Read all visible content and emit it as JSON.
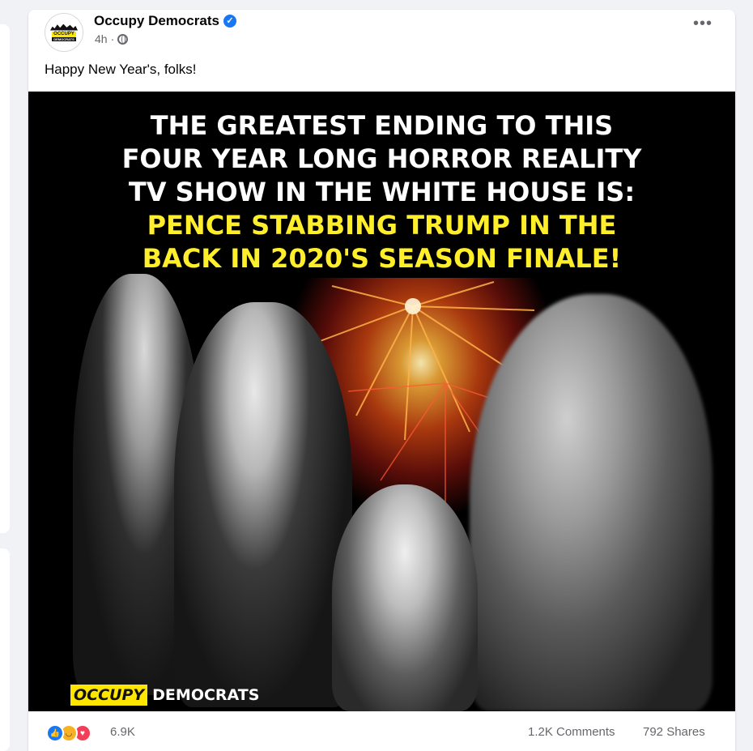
{
  "post": {
    "page_name": "Occupy Democrats",
    "timestamp": "4h",
    "meta_separator": "·",
    "caption": "Happy New Year's, folks!",
    "more_icon": "more-dots-icon",
    "verified_icon": "verified-badge-icon",
    "privacy_icon": "globe-icon"
  },
  "image": {
    "headline_white": [
      "THE GREATEST ENDING TO THIS",
      "FOUR YEAR LONG HORROR REALITY",
      "TV SHOW IN THE WHITE HOUSE IS:"
    ],
    "headline_yellow": [
      "PENCE STABBING TRUMP IN THE",
      "BACK IN 2020'S SEASON FINALE!"
    ],
    "watermark_occupy": "OCCUPY",
    "watermark_democrats": "DEMOCRATS"
  },
  "avatar": {
    "logo_text": "OCCUPY",
    "logo_sub": "DEMOCRATS"
  },
  "engagement": {
    "reactions": [
      "like-icon",
      "haha-icon",
      "love-icon"
    ],
    "reaction_count": "6.9K",
    "comments": "1.2K Comments",
    "shares": "792 Shares"
  },
  "colors": {
    "accent": "#1877f2",
    "headline_yellow": "#ffee2a",
    "text_secondary": "#65676b"
  }
}
